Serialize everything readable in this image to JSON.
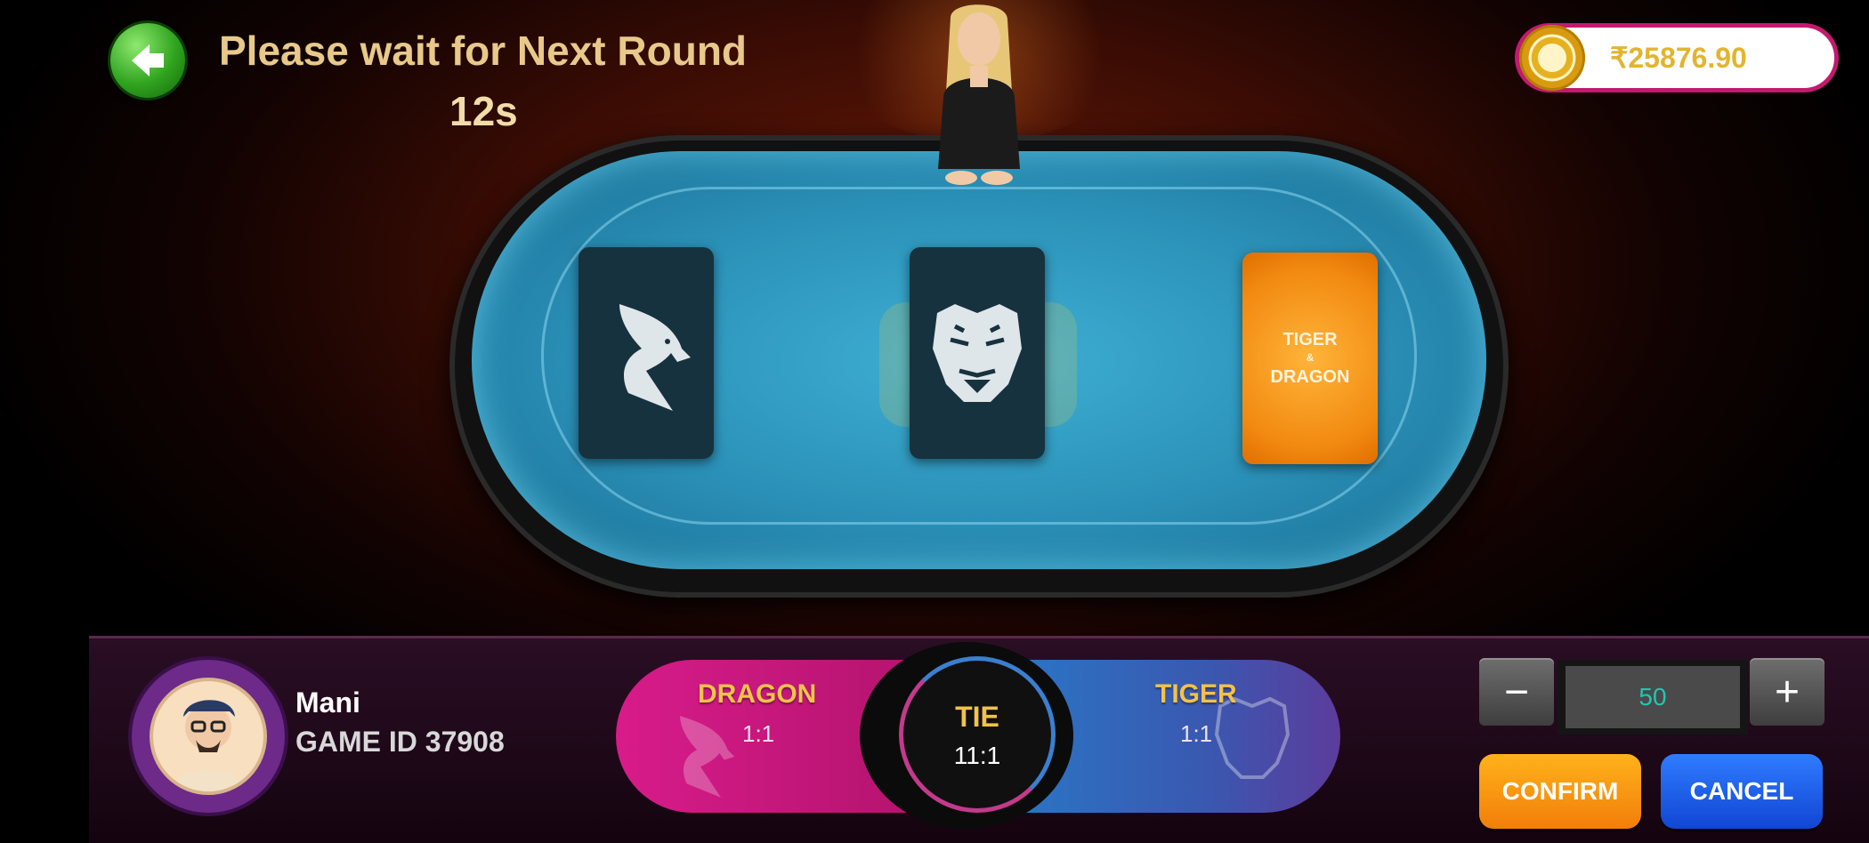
{
  "header": {
    "status_title": "Please wait for Next Round",
    "countdown": "12s"
  },
  "wallet": {
    "balance": "₹25876.90"
  },
  "table": {
    "card_back_line1": "TIGER",
    "card_back_line2": "&",
    "card_back_line3": "DRAGON"
  },
  "player": {
    "name": "Mani",
    "game_id": "GAME ID 37908"
  },
  "bets": {
    "dragon": {
      "label": "DRAGON",
      "odds": "1:1"
    },
    "tie": {
      "label": "TIE",
      "odds": "11:1"
    },
    "tiger": {
      "label": "TIGER",
      "odds": "1:1"
    }
  },
  "controls": {
    "minus": "−",
    "plus": "+",
    "amount": "50",
    "confirm": "CONFIRM",
    "cancel": "CANCEL"
  },
  "colors": {
    "dragon": "#d81b8a",
    "tiger": "#2a76c6",
    "title": "#e8c98a",
    "felt": "#2a8fb6"
  }
}
